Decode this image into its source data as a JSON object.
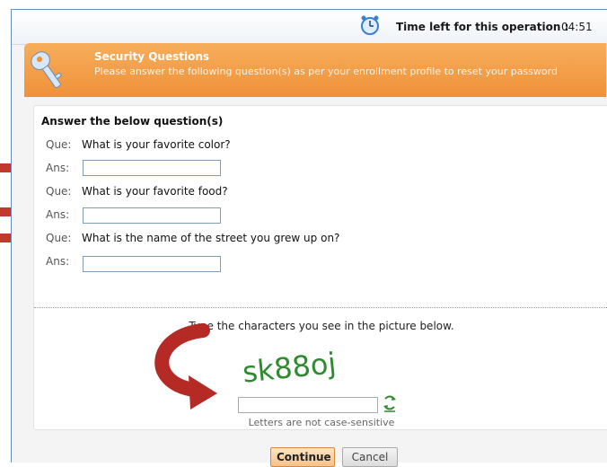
{
  "timer": {
    "label": "Time left for this operation :",
    "value": "04:51"
  },
  "header": {
    "title": "Security Questions",
    "subtitle": "Please answer the following question(s) as per your enrollment profile to reset your password"
  },
  "form": {
    "title": "Answer the below question(s)",
    "que_label": "Que:",
    "ans_label": "Ans:",
    "questions": [
      {
        "question": "What is your favorite color?",
        "answer": ""
      },
      {
        "question": "What is your favorite food?",
        "answer": ""
      },
      {
        "question": "What is the name of the street you grew up on?",
        "answer": ""
      }
    ]
  },
  "captcha": {
    "instruction": "Type the characters you see in the picture below.",
    "image_text": "sk88oj",
    "value": "",
    "note": "Letters are not case-sensitive"
  },
  "buttons": {
    "continue": "Continue",
    "cancel": "Cancel"
  },
  "colors": {
    "header_orange": "#f0913a",
    "arrow_red": "#c0392b",
    "captcha_green": "#2e8b2e"
  }
}
